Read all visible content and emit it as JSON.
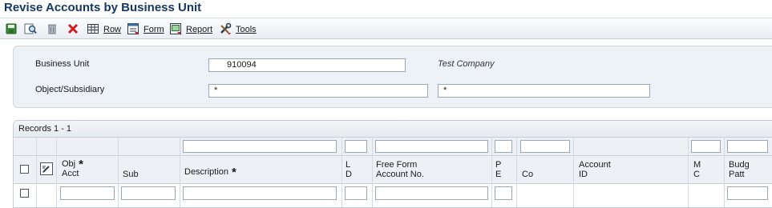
{
  "window": {
    "title": "Revise Accounts by Business Unit"
  },
  "toolbar": {
    "save_icon": "save-icon",
    "find_icon": "find-icon",
    "delete_icon": "delete-icon",
    "cancel_icon": "cancel-icon",
    "row_label": "Row",
    "form_label": "Form",
    "report_label": "Report",
    "tools_label": "Tools"
  },
  "header": {
    "business_unit_label": "Business Unit",
    "business_unit_value": "910094",
    "business_unit_desc": "Test Company",
    "object_subsidiary_label": "Object/Subsidiary",
    "object_value": "*",
    "subsidiary_value": "*"
  },
  "grid": {
    "records_text": "Records 1 - 1",
    "columns": [
      {
        "key": "obj_acct",
        "line1": "Obj",
        "line2": "Acct",
        "required": true
      },
      {
        "key": "sub",
        "line1": "",
        "line2": "Sub",
        "required": false
      },
      {
        "key": "description",
        "line1": "",
        "line2": "Description",
        "required": true
      },
      {
        "key": "ld",
        "line1": "L",
        "line2": "D",
        "required": false
      },
      {
        "key": "free_form",
        "line1": "Free Form",
        "line2": "Account No.",
        "required": false
      },
      {
        "key": "pe",
        "line1": "P",
        "line2": "E",
        "required": false
      },
      {
        "key": "co",
        "line1": "",
        "line2": "Co",
        "required": false
      },
      {
        "key": "account_id",
        "line1": "Account",
        "line2": "ID",
        "required": false
      },
      {
        "key": "mc",
        "line1": "M",
        "line2": "C",
        "required": false
      },
      {
        "key": "budg_patt",
        "line1": "Budg",
        "line2": "Patt",
        "required": false
      }
    ],
    "required_marker": "*"
  },
  "colors": {
    "title": "#17375e",
    "panel_bg": "#edf2f7",
    "border": "#c5ced8"
  }
}
